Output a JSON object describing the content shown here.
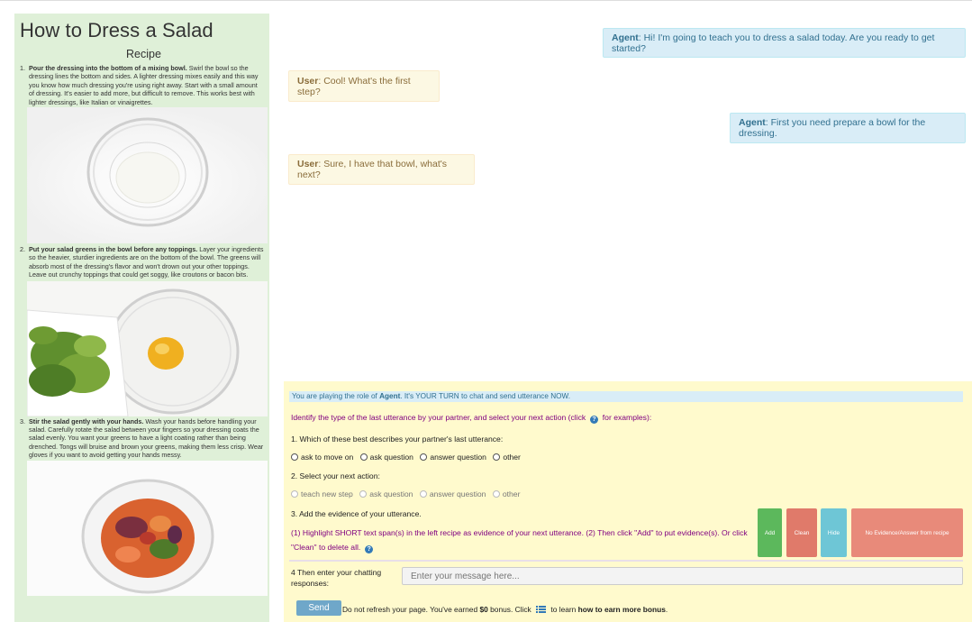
{
  "recipe": {
    "title": "How to Dress a Salad",
    "subtitle": "Recipe",
    "steps": [
      {
        "num": "1.",
        "bold": "Pour the dressing into the bottom of a mixing bowl.",
        "text": " Swirl the bowl so the dressing lines the bottom and sides. A lighter dressing mixes easily and this way you know how much dressing you're using right away. Start with a small amount of dressing. It's easier to add more, but difficult to remove. This works best with lighter dressings, like Italian or vinaigrettes."
      },
      {
        "num": "2.",
        "bold": "Put your salad greens in the bowl before any toppings.",
        "text": " Layer your ingredients so the heavier, sturdier ingredients are on the bottom of the bowl. The greens will absorb most of the dressing's flavor and won't drown out your other toppings. Leave out crunchy toppings that could get soggy, like croutons or bacon bits."
      },
      {
        "num": "3.",
        "bold": "Stir the salad gently with your hands.",
        "text": " Wash your hands before handling your salad. Carefully rotate the salad between your fingers so your dressing coats the salad evenly. You want your greens to have a light coating rather than being drenched. Tongs will bruise and brown your greens, making them less crisp. Wear gloves if you want to avoid getting your hands messy."
      }
    ]
  },
  "chat": [
    {
      "speaker": "Agent",
      "text": ": Hi! I'm going to teach you to dress a salad today. Are you ready to get started?"
    },
    {
      "speaker": "User",
      "text": ": Cool! What's the first step?"
    },
    {
      "speaker": "Agent",
      "text": ": First you need prepare a bowl for the dressing."
    },
    {
      "speaker": "User",
      "text": ": Sure, I have that bowl, what's next?"
    }
  ],
  "panel": {
    "role_pre": "You are playing the role of ",
    "role_name": "Agent",
    "role_post": ". It's YOUR TURN to chat and send utterance NOW.",
    "identify_pre": "Identify the type of the last utterance by your partner, and select your next action (click",
    "identify_post": "for examples):",
    "q1": "1. Which of these best describes your partner's last utterance:",
    "q1_options": [
      "ask to move on",
      "ask question",
      "answer question",
      "other"
    ],
    "q2": "2. Select your next action:",
    "q2_options": [
      "teach new step",
      "ask question",
      "answer question",
      "other"
    ],
    "q3": "3. Add the evidence of your utterance.",
    "q3_help": "(1) Highlight SHORT text span(s) in the left recipe as evidence of your next utterance. (2) Then click \"Add\" to put evidence(s). Or click \"Clean\" to delete all.",
    "buttons": {
      "add": "Add",
      "clean": "Clean",
      "hide": "Hide",
      "no_evidence": "No Evidence/Answer from recipe"
    },
    "q4": "4 Then enter your chatting responses:",
    "input_placeholder": "Enter your message here...",
    "send": "Send",
    "footer_pre": "Do not refresh your page. You've earned ",
    "bonus": "$0",
    "footer_mid": " bonus. Click",
    "footer_mid2": "to learn ",
    "footer_link": "how to earn more bonus",
    "footer_end": "."
  },
  "colors": {
    "agent_bg": "#d9edf7",
    "user_bg": "#fcf8e3",
    "recipe_bg": "#dff0d8",
    "panel_bg": "#fffacd",
    "add": "#5cb85c",
    "clean": "#e07a6a",
    "hide": "#6ec6d6",
    "no_evidence": "#e88a7a"
  }
}
